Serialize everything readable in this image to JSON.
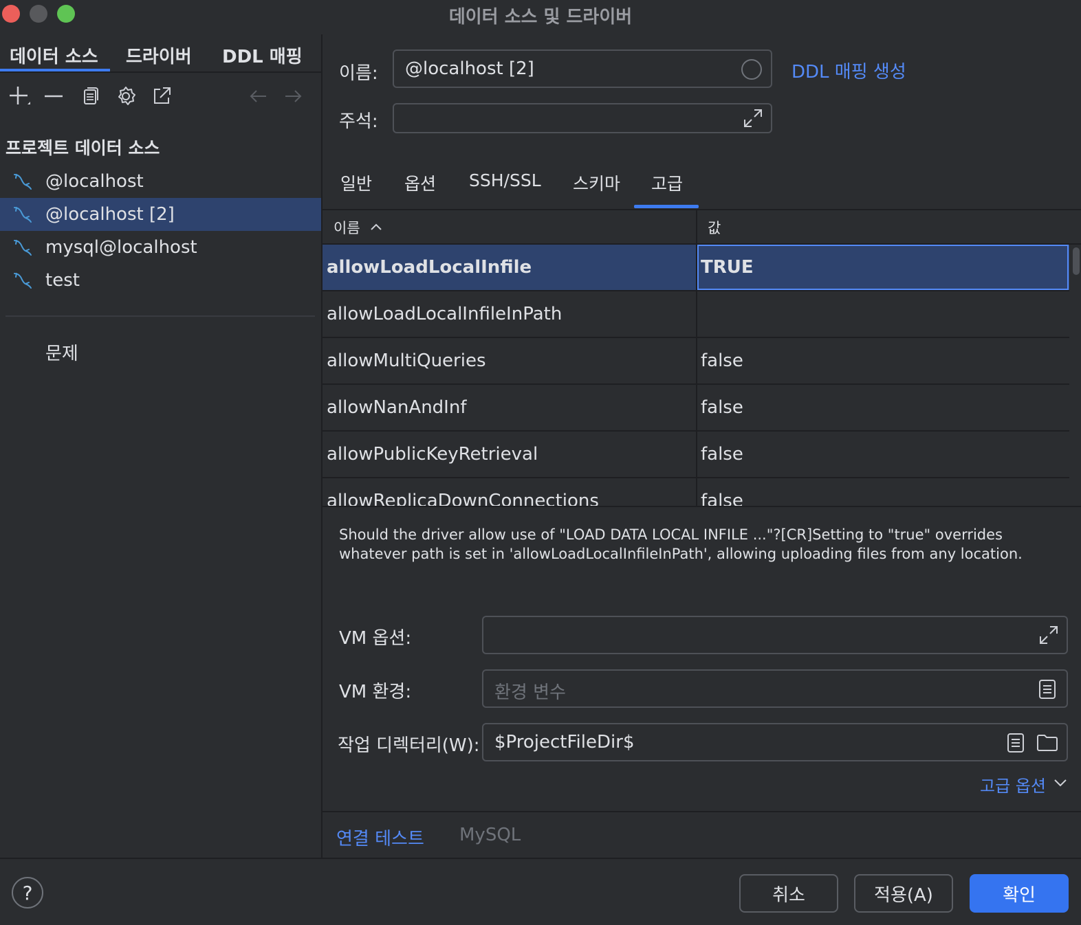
{
  "window": {
    "title": "데이터 소스 및 드라이버"
  },
  "left": {
    "tabs": [
      "데이터 소스",
      "드라이버",
      "DDL 매핑"
    ],
    "section_title": "프로젝트 데이터 소스",
    "items": [
      {
        "label": "@localhost"
      },
      {
        "label": "@localhost [2]"
      },
      {
        "label": "mysql@localhost"
      },
      {
        "label": "test"
      }
    ],
    "problems": "문제"
  },
  "right": {
    "name_label": "이름:",
    "name_value": "@localhost [2]",
    "ddl_link": "DDL 매핑 생성",
    "comment_label": "주석:",
    "tabs": [
      "일반",
      "옵션",
      "SSH/SSL",
      "스키마",
      "고급"
    ],
    "active_tab": "고급",
    "table": {
      "col_name": "이름",
      "col_value": "값",
      "rows": [
        {
          "name": "allowLoadLocalInfile",
          "value": "TRUE"
        },
        {
          "name": "allowLoadLocalInfileInPath",
          "value": ""
        },
        {
          "name": "allowMultiQueries",
          "value": "false"
        },
        {
          "name": "allowNanAndInf",
          "value": "false"
        },
        {
          "name": "allowPublicKeyRetrieval",
          "value": "false"
        },
        {
          "name": "allowReplicaDownConnections",
          "value": "false"
        }
      ]
    },
    "description_line1": "Should the driver allow use of \"LOAD DATA LOCAL INFILE ...\"?[CR]Setting to \"true\" overrides",
    "description_line2": "whatever path is set in 'allowLoadLocalInfileInPath', allowing uploading files from any location.",
    "vm_options_label": "VM 옵션:",
    "vm_env_label": "VM 환경:",
    "vm_env_placeholder": "환경 변수",
    "workdir_label": "작업 디렉터리(W):",
    "workdir_value": "$ProjectFileDir$",
    "advanced_options": "고급 옵션",
    "test_connection": "연결 테스트",
    "driver_name": "MySQL"
  },
  "footer": {
    "help": "?",
    "cancel": "취소",
    "apply": "적용(A)",
    "ok": "확인"
  },
  "colors": {
    "accent": "#3574f0",
    "link": "#548af7",
    "selection": "#2e436e",
    "background": "#2b2d30"
  }
}
